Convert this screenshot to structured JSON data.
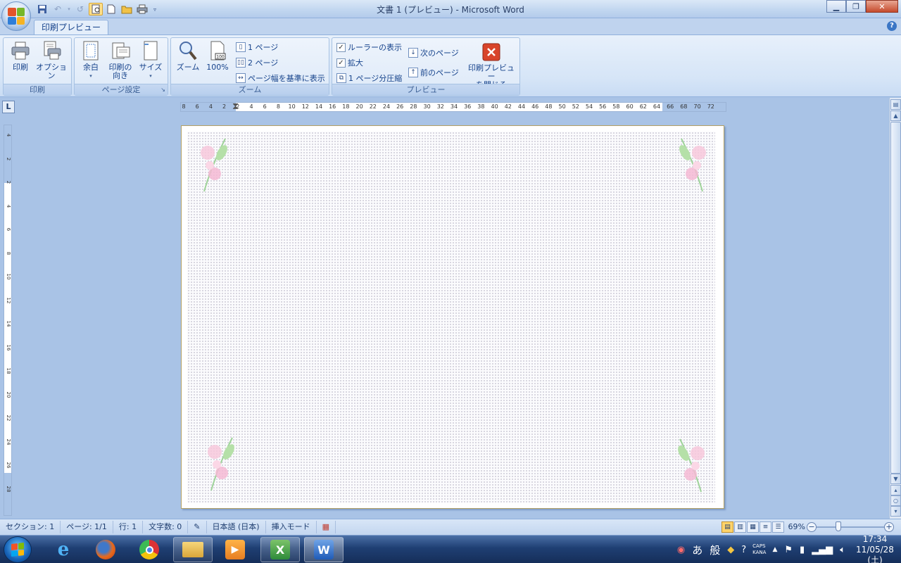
{
  "window": {
    "title": "文書 1 (プレビュー) - Microsoft Word"
  },
  "ribbon": {
    "tab": "印刷プレビュー",
    "groups": {
      "print": {
        "label": "印刷",
        "print": "印刷",
        "options": "オプション"
      },
      "page_setup": {
        "label": "ページ設定",
        "margins": "余白",
        "orientation_1": "印刷の",
        "orientation_2": "向き",
        "size": "サイズ"
      },
      "zoom": {
        "label": "ズーム",
        "zoom": "ズーム",
        "hundred": "100%",
        "one_page": "1 ページ",
        "two_pages": "2 ページ",
        "page_width": "ページ幅を基準に表示"
      },
      "preview": {
        "label": "プレビュー",
        "show_ruler": "ルーラーの表示",
        "magnifier": "拡大",
        "shrink": "1 ページ分圧縮",
        "next": "次のページ",
        "prev": "前のページ",
        "close_1": "印刷プレビュー",
        "close_2": "を閉じる"
      }
    }
  },
  "ruler": {
    "h_ticks": [
      "8",
      "6",
      "4",
      "2",
      "2",
      "4",
      "6",
      "8",
      "10",
      "12",
      "14",
      "16",
      "18",
      "20",
      "22",
      "24",
      "26",
      "28",
      "30",
      "32",
      "34",
      "36",
      "38",
      "40",
      "42",
      "44",
      "46",
      "48",
      "50",
      "52",
      "54",
      "56",
      "58",
      "60",
      "62",
      "64",
      "66",
      "68",
      "70",
      "72"
    ],
    "v_ticks": [
      "4",
      "2",
      "2",
      "4",
      "6",
      "8",
      "10",
      "12",
      "14",
      "16",
      "18",
      "20",
      "22",
      "24",
      "26",
      "28"
    ]
  },
  "statusbar": {
    "section": "セクション: 1",
    "page": "ページ: 1/1",
    "line": "行: 1",
    "chars": "文字数: 0",
    "language": "日本語 (日本)",
    "mode": "挿入モード",
    "zoom": "69%",
    "zoom_level": 0.69
  },
  "taskbar": {
    "time": "17:34",
    "date": "11/05/28 (土)",
    "ime_a": "あ",
    "ime_mode": "般",
    "caps": "CAPS",
    "kana": "KANA"
  },
  "colors": {
    "ribbon_text": "#15428b",
    "workspace": "#a9c3e6",
    "accent_active": "#ffd36a"
  }
}
